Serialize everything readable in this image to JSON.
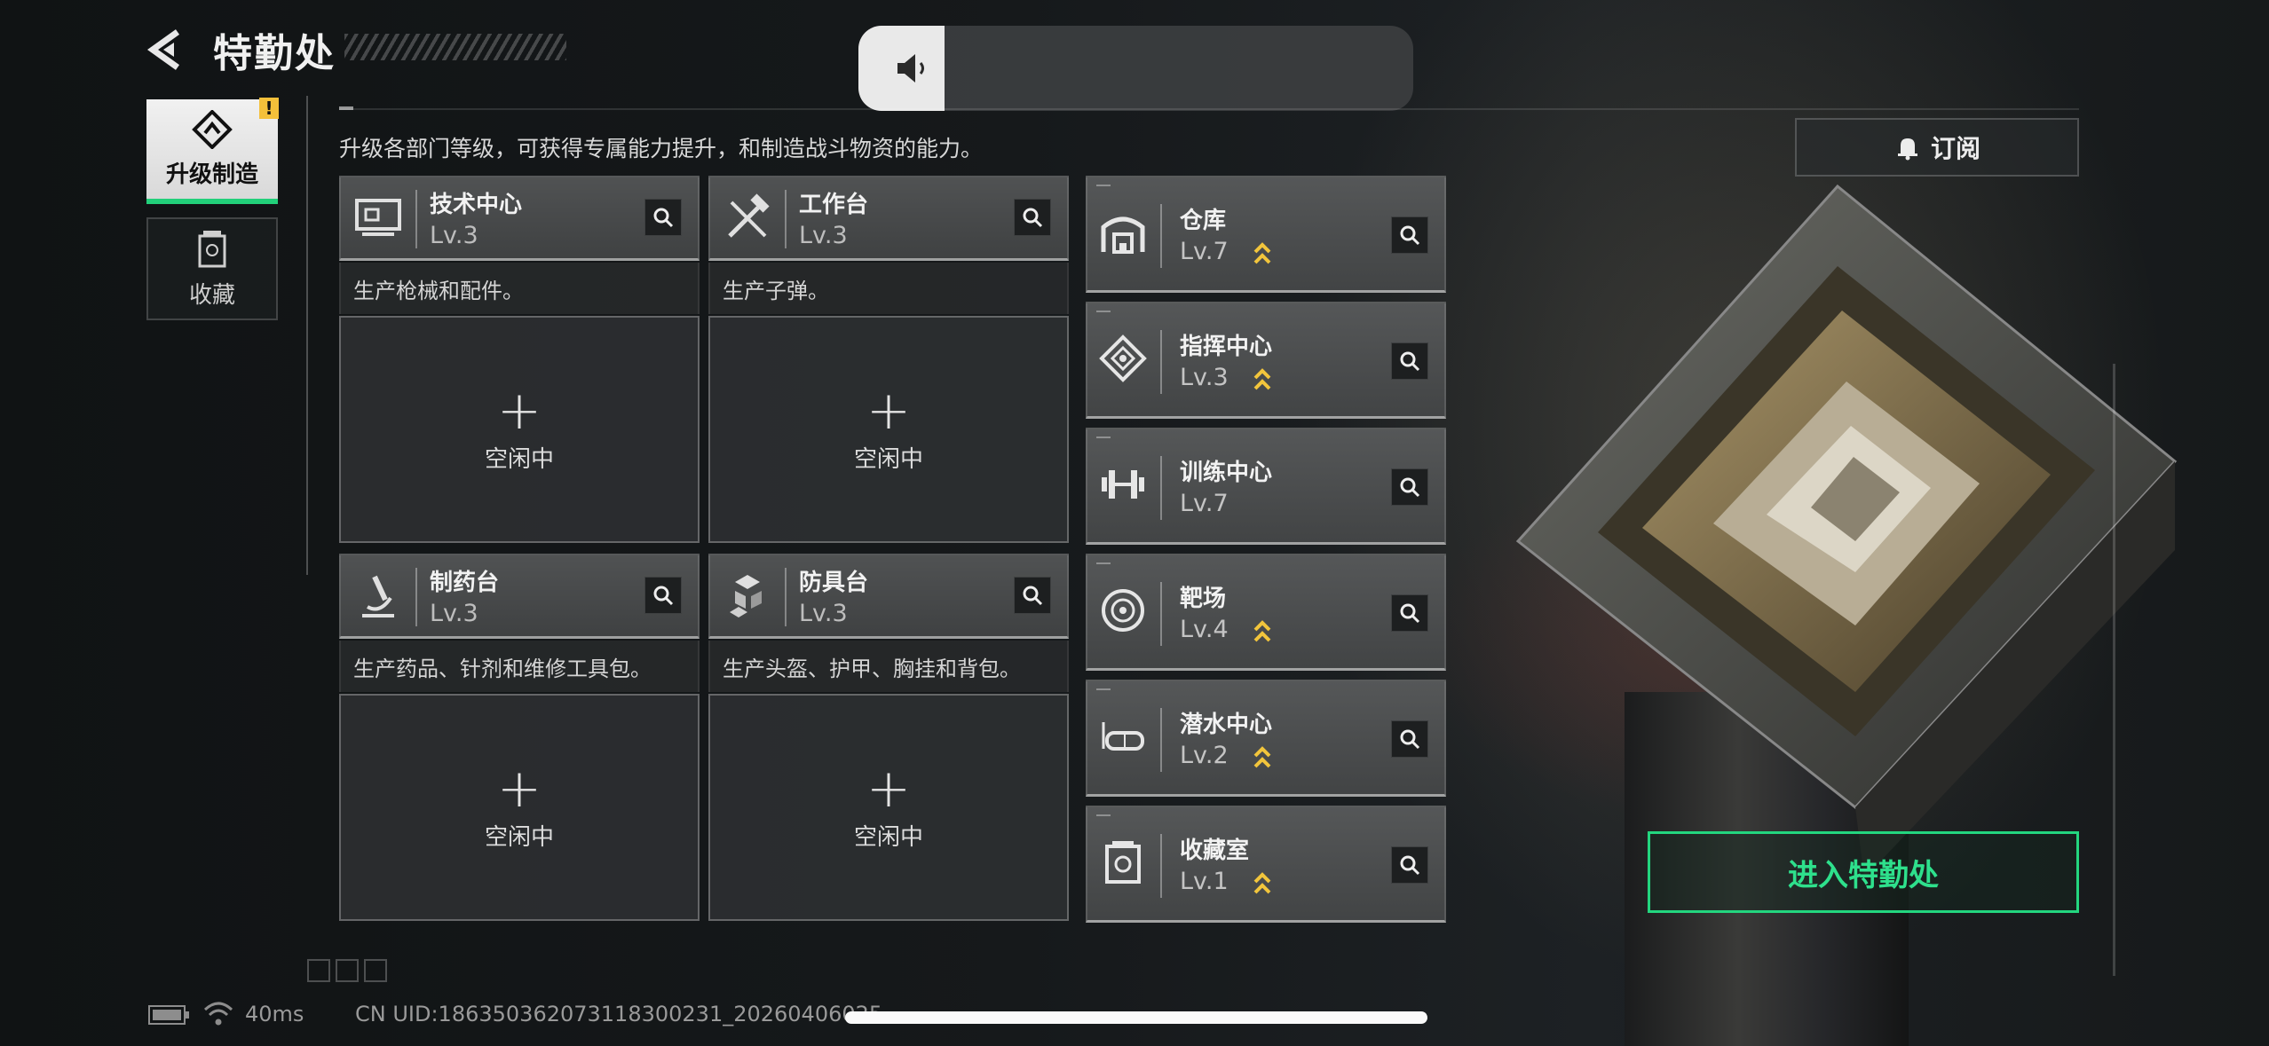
{
  "header": {
    "title": "特勤处"
  },
  "volume": {
    "level_fraction": 0.155
  },
  "tabs": [
    {
      "label": "升级制造",
      "active": true,
      "icon": "upgrade-icon",
      "has_alert": true,
      "alert_text": "!"
    },
    {
      "label": "收藏",
      "active": false,
      "icon": "collection-icon"
    }
  ],
  "description": "升级各部门等级，可获得专属能力提升，和制造战斗物资的能力。",
  "production": [
    {
      "name": "技术中心",
      "level": "Lv.3",
      "sub": "生产枪械和配件。",
      "slot_plus": "+",
      "slot_status": "空闲中",
      "icon": "monitor-icon"
    },
    {
      "name": "工作台",
      "level": "Lv.3",
      "sub": "生产子弹。",
      "slot_plus": "+",
      "slot_status": "空闲中",
      "icon": "tools-icon"
    },
    {
      "name": "制药台",
      "level": "Lv.3",
      "sub": "生产药品、针剂和维修工具包。",
      "slot_plus": "+",
      "slot_status": "空闲中",
      "icon": "microscope-icon"
    },
    {
      "name": "防具台",
      "level": "Lv.3",
      "sub": "生产头盔、护甲、胸挂和背包。",
      "slot_plus": "+",
      "slot_status": "空闲中",
      "icon": "armor-icon"
    }
  ],
  "facilities": [
    {
      "name": "仓库",
      "level": "Lv.7",
      "upgradable": true,
      "icon": "warehouse-icon"
    },
    {
      "name": "指挥中心",
      "level": "Lv.3",
      "upgradable": true,
      "icon": "command-icon"
    },
    {
      "name": "训练中心",
      "level": "Lv.7",
      "upgradable": false,
      "icon": "dumbbell-icon"
    },
    {
      "name": "靶场",
      "level": "Lv.4",
      "upgradable": true,
      "icon": "target-icon"
    },
    {
      "name": "潜水中心",
      "level": "Lv.2",
      "upgradable": true,
      "icon": "diving-mask-icon"
    },
    {
      "name": "收藏室",
      "level": "Lv.1",
      "upgradable": true,
      "icon": "collection-room-icon"
    }
  ],
  "subscribe_label": "订阅",
  "enter_label": "进入特勤处",
  "status": {
    "ping": "40ms",
    "uid": "CN UID:1863503620731183002​31_20260406025"
  },
  "colors": {
    "accent_green": "#23d67f",
    "upgrade_gold": "#f2c53c",
    "alert_yellow": "#f4c03a"
  }
}
